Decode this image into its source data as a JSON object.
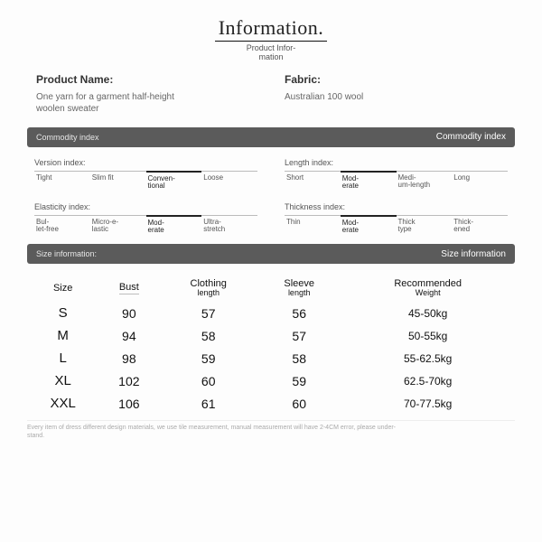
{
  "heading": {
    "title": "Information.",
    "subtitle": "Product Infor-\nmation"
  },
  "product": {
    "name_label": "Product Name:",
    "name_value": "One yarn for a garment half-height woolen sweater",
    "fabric_label": "Fabric:",
    "fabric_value": "Australian 100 wool"
  },
  "sections": {
    "commodity_left": "Commodity index",
    "commodity_right": "Commodity index",
    "size_left": "Size information:",
    "size_right": "Size information"
  },
  "indices": {
    "version": {
      "title": "Version index:",
      "items": [
        "Tight",
        "Slim fit",
        "Conven-\ntional",
        "Loose"
      ],
      "selected": 2
    },
    "length": {
      "title": "Length index:",
      "items": [
        "Short",
        "Mod-\nerate",
        "Medi-\num-length",
        "Long"
      ],
      "selected": 1
    },
    "elasticity": {
      "title": "Elasticity index:",
      "items": [
        "Bul-\nlet-free",
        "Micro-e-\nlastic",
        "Mod-\nerate",
        "Ultra-\nstretch"
      ],
      "selected": 2
    },
    "thickness": {
      "title": "Thickness index:",
      "items": [
        "Thin",
        "Mod-\nerate",
        "Thick\ntype",
        "Thick-\nened"
      ],
      "selected": 1
    }
  },
  "size_table": {
    "headers": [
      "Size",
      "Bust",
      "Clothing\nlength",
      "Sleeve\nlength",
      "Recommended\nWeight"
    ],
    "rows": [
      {
        "size": "S",
        "bust": "90",
        "clothing": "57",
        "sleeve": "56",
        "weight": "45-50kg"
      },
      {
        "size": "M",
        "bust": "94",
        "clothing": "58",
        "sleeve": "57",
        "weight": "50-55kg"
      },
      {
        "size": "L",
        "bust": "98",
        "clothing": "59",
        "sleeve": "58",
        "weight": "55-62.5kg"
      },
      {
        "size": "XL",
        "bust": "102",
        "clothing": "60",
        "sleeve": "59",
        "weight": "62.5-70kg"
      },
      {
        "size": "XXL",
        "bust": "106",
        "clothing": "61",
        "sleeve": "60",
        "weight": "70-77.5kg"
      }
    ]
  },
  "footnote": "Every item of dress different design materials, we use tile measurement, manual measurement will have 2-4CM error, please under-\nstand."
}
